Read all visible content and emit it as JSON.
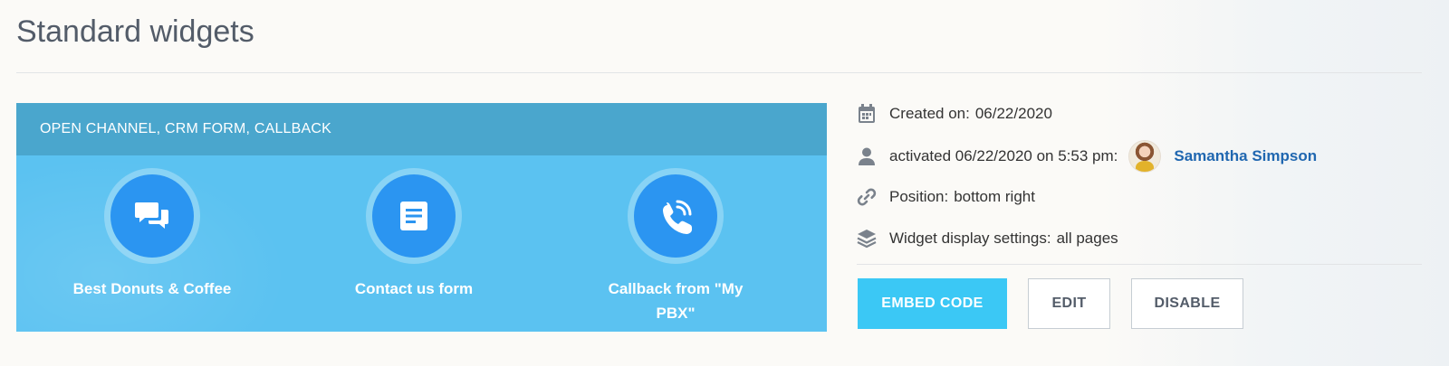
{
  "page": {
    "title": "Standard widgets"
  },
  "widget": {
    "header": "OPEN CHANNEL, CRM FORM, CALLBACK",
    "channels": [
      {
        "label": "Best Donuts & Coffee",
        "icon": "chat-bubbles-icon"
      },
      {
        "label": "Contact us form",
        "icon": "form-document-icon"
      },
      {
        "label": "Callback from \"My PBX\"",
        "icon": "phone-call-icon"
      }
    ]
  },
  "info": {
    "created_label": "Created on:",
    "created_value": "06/22/2020",
    "activated_label": "activated 06/22/2020 on 5:53 pm:",
    "activated_user": "Samantha Simpson",
    "position_label": "Position:",
    "position_value": "bottom right",
    "display_label": "Widget display settings:",
    "display_value": "all pages"
  },
  "buttons": {
    "embed": "EMBED CODE",
    "edit": "EDIT",
    "disable": "DISABLE"
  },
  "colors": {
    "card": "#5bc2f1",
    "card_header": "#4aa6cd",
    "icon_circle": "#2b95f1",
    "primary_button": "#3bc8f5",
    "user_link": "#2067b0"
  }
}
